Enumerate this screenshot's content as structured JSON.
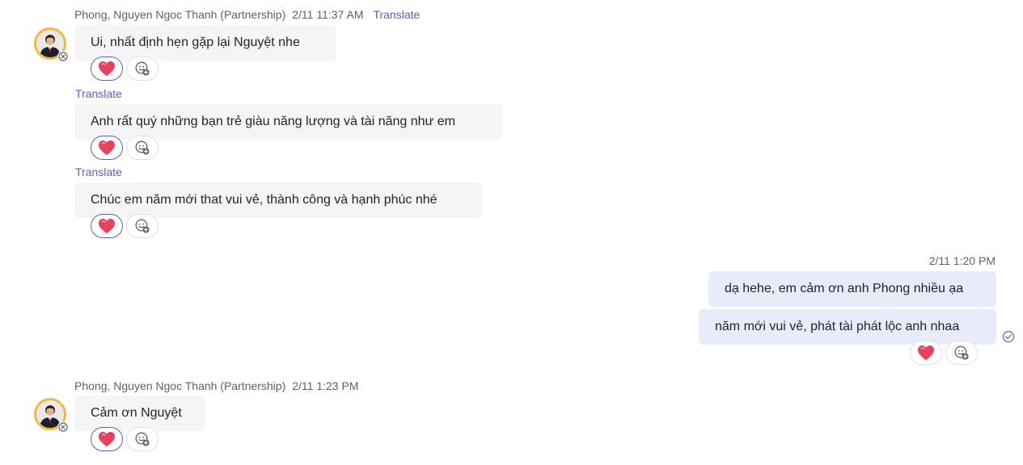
{
  "colors": {
    "accent": "#5b5fc7",
    "incoming_bubble": "#f5f5f5",
    "outgoing_bubble": "#e8ebfa",
    "heart": "#e8415f",
    "avatar_ring": "#f6b53b"
  },
  "icons": {
    "reaction": "heart-icon",
    "add_reaction": "add-reaction-icon",
    "avatar_status": "offline-status-icon",
    "read_receipt": "seen-check-icon"
  },
  "group1": {
    "sender": "Phong, Nguyen Ngoc Thanh (Partnership)",
    "time": "2/11 11:37 AM",
    "translate": "Translate",
    "messages": [
      {
        "text": "Ui, nhất định hẹn gặp lại Nguyệt nhe"
      },
      {
        "translate": "Translate",
        "text": "Anh rất quý những bạn trẻ giàu năng lượng và tài năng như em"
      },
      {
        "translate": "Translate",
        "text": "Chúc em năm mới that vui vẻ, thành công và hạnh phúc nhé"
      }
    ]
  },
  "group2": {
    "time": "2/11 1:20 PM",
    "messages": [
      {
        "text": "dạ hehe, em cảm ơn anh Phong nhiều ạa"
      },
      {
        "text": "năm mới vui vẻ, phát tài phát lộc anh nhaa"
      }
    ]
  },
  "group3": {
    "sender": "Phong, Nguyen Ngoc Thanh (Partnership)",
    "time": "2/11 1:23 PM",
    "messages": [
      {
        "text": "Cảm ơn Nguyệt"
      }
    ]
  }
}
